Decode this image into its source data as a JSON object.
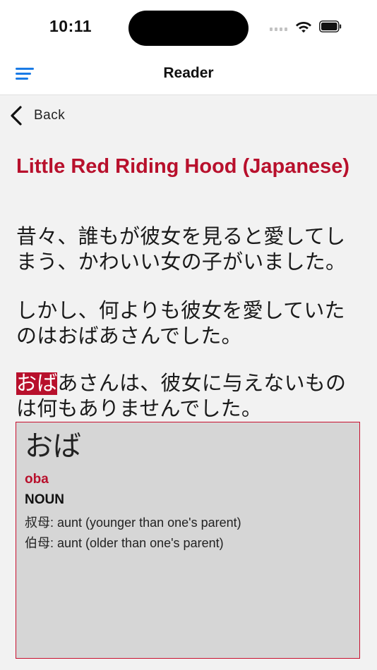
{
  "status": {
    "time": "10:11"
  },
  "nav": {
    "title": "Reader"
  },
  "back": {
    "label": "Back"
  },
  "story": {
    "title": "Little Red Riding Hood (Japanese)",
    "paragraph1": "昔々、誰もが彼女を見ると愛してしまう、かわいい女の子がいました。",
    "paragraph2": "しかし、何よりも彼女を愛していたのはおばあさんでした。",
    "paragraph3_highlight": "おば",
    "paragraph3_rest": "あさんは、彼女に与えないものは何もありませんでした。"
  },
  "dictionary": {
    "word": "おば",
    "romaji": "oba",
    "part_of_speech": "NOUN",
    "definitions": [
      "叔母: aunt (younger than one's parent)",
      "伯母: aunt (older than one's parent)"
    ]
  },
  "colors": {
    "accent": "#b8102c",
    "link": "#1a7be6"
  },
  "icons": {
    "menu": "hamburger-icon",
    "back": "chevron-left-icon",
    "wifi": "wifi-icon",
    "battery": "battery-icon",
    "signal": "signal-icon"
  }
}
